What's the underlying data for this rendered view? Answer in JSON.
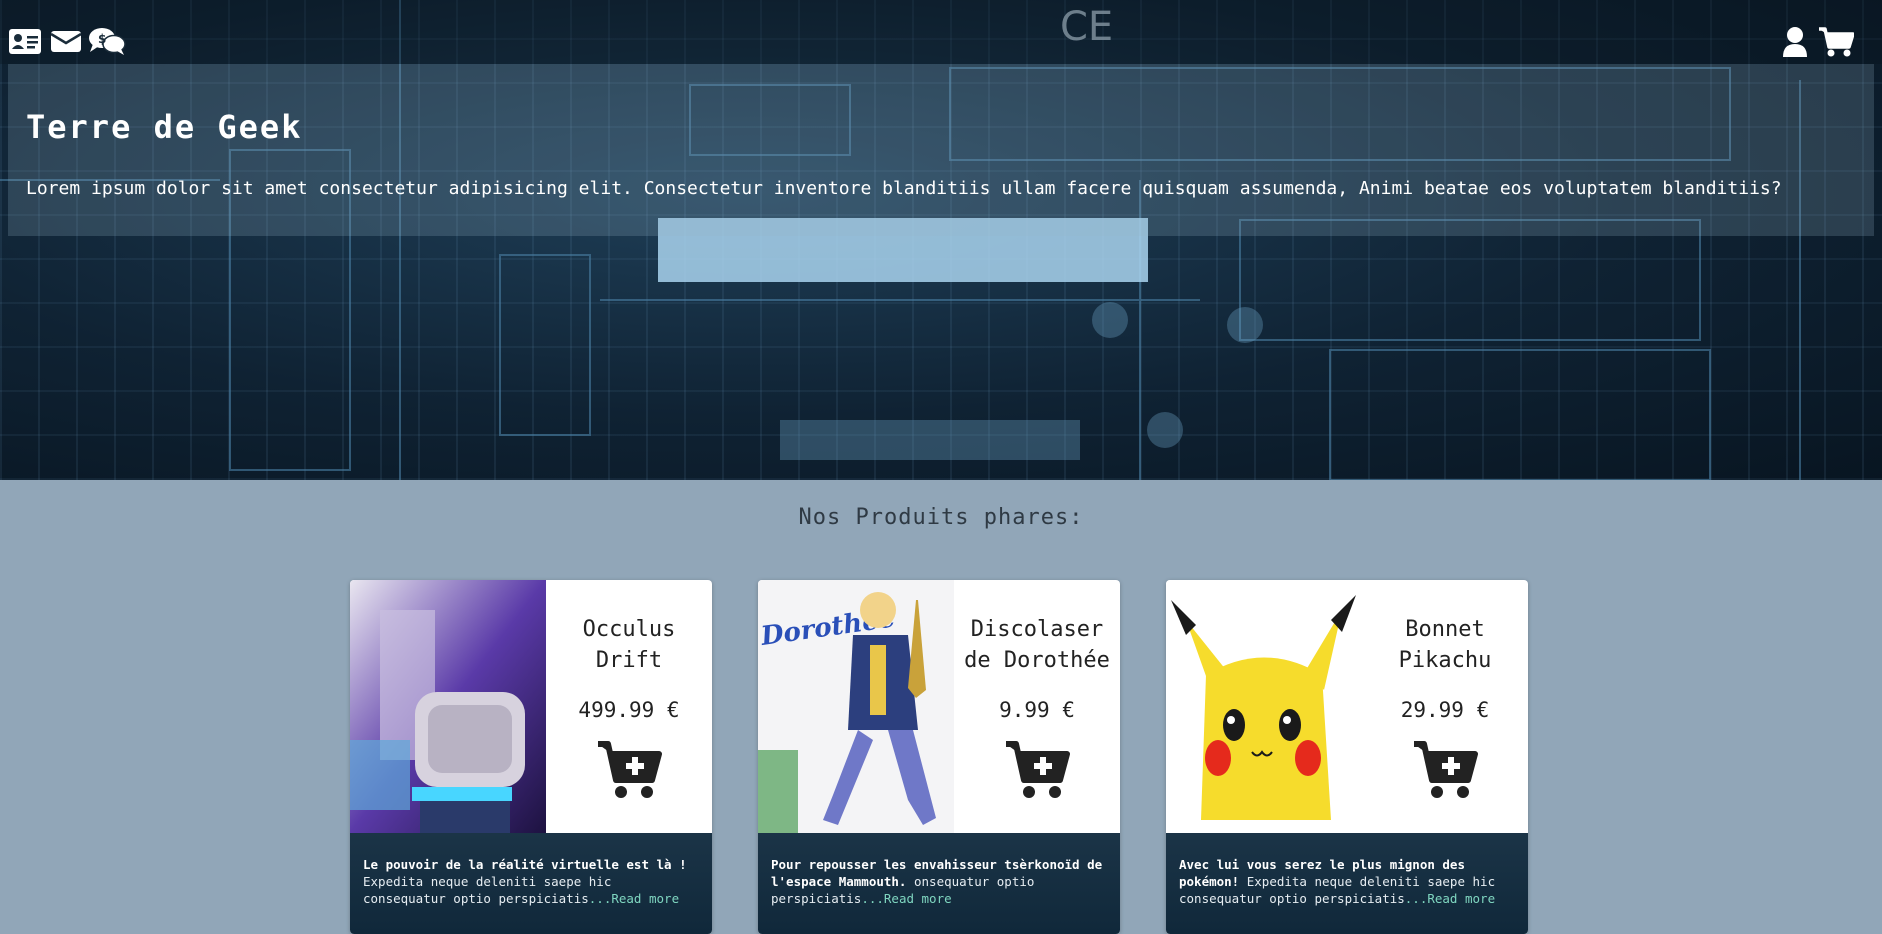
{
  "header": {
    "icons": [
      "id-card-icon",
      "envelope-icon",
      "comments-dollar-icon",
      "user-icon",
      "shopping-cart-icon"
    ]
  },
  "banner": {
    "title": "Terre de Geek",
    "text": "Lorem ipsum dolor sit amet consectetur adipisicing elit. Consectetur inventore blanditiis ullam facere quisquam assumenda, Animi beatae eos voluptatem blanditiis?"
  },
  "products": {
    "heading": "Nos Produits phares:",
    "items": [
      {
        "name": "Occulus Drift",
        "price": "499.99 €",
        "desc_bold": "Le pouvoir de la réalité virtuelle est là !",
        "desc_text": " Expedita neque deleniti saepe hic consequatur optio perspiciatis",
        "more": "...Read more"
      },
      {
        "name": "Discolaser de Dorothée",
        "price": "9.99 €",
        "desc_bold": "Pour repousser les envahisseur tsèrkonoïd de l'espace Mammouth.",
        "desc_text": " onsequatur optio perspiciatis",
        "more": "...Read more"
      },
      {
        "name": "Bonnet Pikachu",
        "price": "29.99 €",
        "desc_bold": "Avec lui vous serez le plus mignon des pokémon!",
        "desc_text": " Expedita neque deleniti saepe hic consequatur optio perspiciatis",
        "more": "...Read more"
      }
    ]
  },
  "colors": {
    "page_bg": "#91a6b8",
    "desc_bg": "#10283a",
    "link": "#7fd6c0"
  }
}
